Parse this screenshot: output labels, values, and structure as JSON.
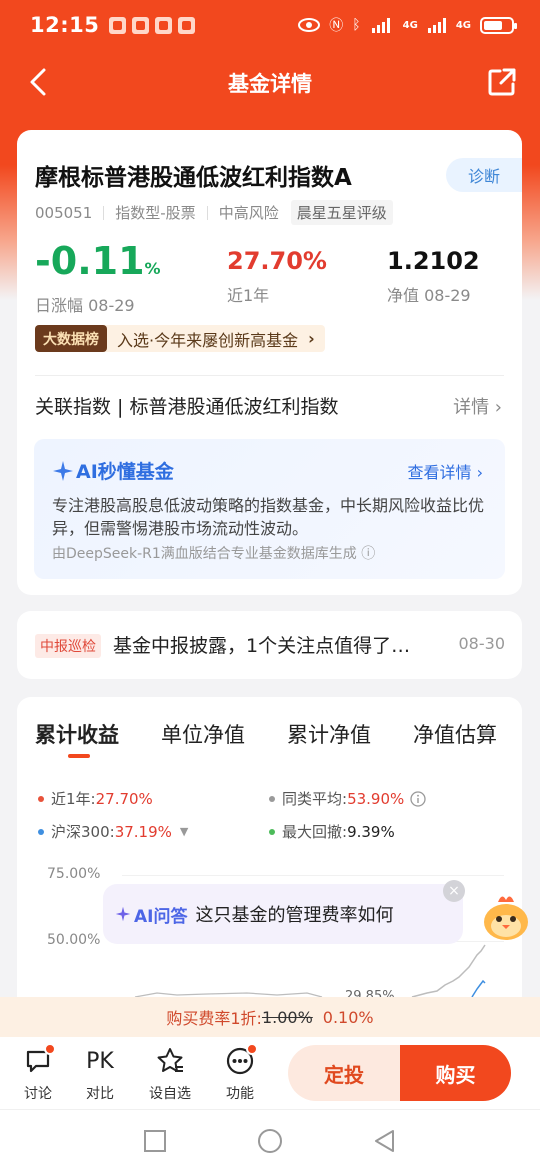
{
  "status_bar": {
    "time": "12:15",
    "net1": "4G",
    "net2": "4G"
  },
  "nav": {
    "title": "基金详情"
  },
  "fund": {
    "name": "摩根标普港股通低波红利指数A",
    "diagnose": "诊断",
    "code": "005051",
    "type": "指数型-股票",
    "risk": "中高风险",
    "rating": "晨星五星评级"
  },
  "stats": {
    "daily": {
      "value": "-0.11",
      "unit": "%",
      "label": "日涨幅 08-29"
    },
    "year": {
      "value": "27.70%",
      "label": "近1年"
    },
    "nav": {
      "value": "1.2102",
      "label": "净值 08-29"
    }
  },
  "bigdata": {
    "badge": "大数据榜",
    "text": "入选·今年来屡创新高基金",
    "arrow": "›"
  },
  "related": {
    "label": "关联指数 | 标普港股通低波红利指数",
    "more": "详情 ›"
  },
  "ai_summary": {
    "title": "AI秒懂基金",
    "more": "查看详情 ›",
    "desc": "专注港股高股息低波动策略的指数基金，中长期风险收益比优异，但需警惕港股市场流动性波动。",
    "source": "由DeepSeek-R1满血版结合专业基金数据库生成 ⓘ"
  },
  "news": {
    "tag": "中报巡检",
    "text": "基金中报披露，1个关注点值得了…",
    "date": "08-30"
  },
  "tabs": [
    "累计收益",
    "单位净值",
    "累计净值",
    "净值估算"
  ],
  "legend": {
    "fund": {
      "label": "近1年:",
      "value": "27.70%",
      "color": "#e8523a"
    },
    "peer": {
      "label": "同类平均:",
      "value": "53.90%",
      "color": "#9a9a9a"
    },
    "hs300": {
      "label": "沪深300:",
      "value": "37.19%",
      "color": "#3f8fe0"
    },
    "drawdown": {
      "label": "最大回撤:",
      "value": "9.39%",
      "color": "#4cbb5a"
    }
  },
  "chart": {
    "y_labels": [
      "75.00%",
      "50.00%"
    ],
    "peek_label": "29.85%"
  },
  "ai_bubble": {
    "tag": "AI问答",
    "text": "这只基金的管理费率如何",
    "close": "×"
  },
  "fee": {
    "prefix": "购买费率1折:",
    "old": "1.00%",
    "new": "0.10%"
  },
  "bottom": {
    "items": [
      {
        "label": "讨论",
        "icon": "discuss-icon"
      },
      {
        "label": "对比",
        "icon": "PK"
      },
      {
        "label": "设自选",
        "icon": "star-plus-icon"
      },
      {
        "label": "功能",
        "icon": "more-icon"
      }
    ],
    "dingtou": "定投",
    "buy": "购买"
  },
  "colors": {
    "brand": "#f2481e",
    "up": "#e23c2f",
    "down": "#17a85a",
    "ai_blue": "#2f6ee0"
  }
}
